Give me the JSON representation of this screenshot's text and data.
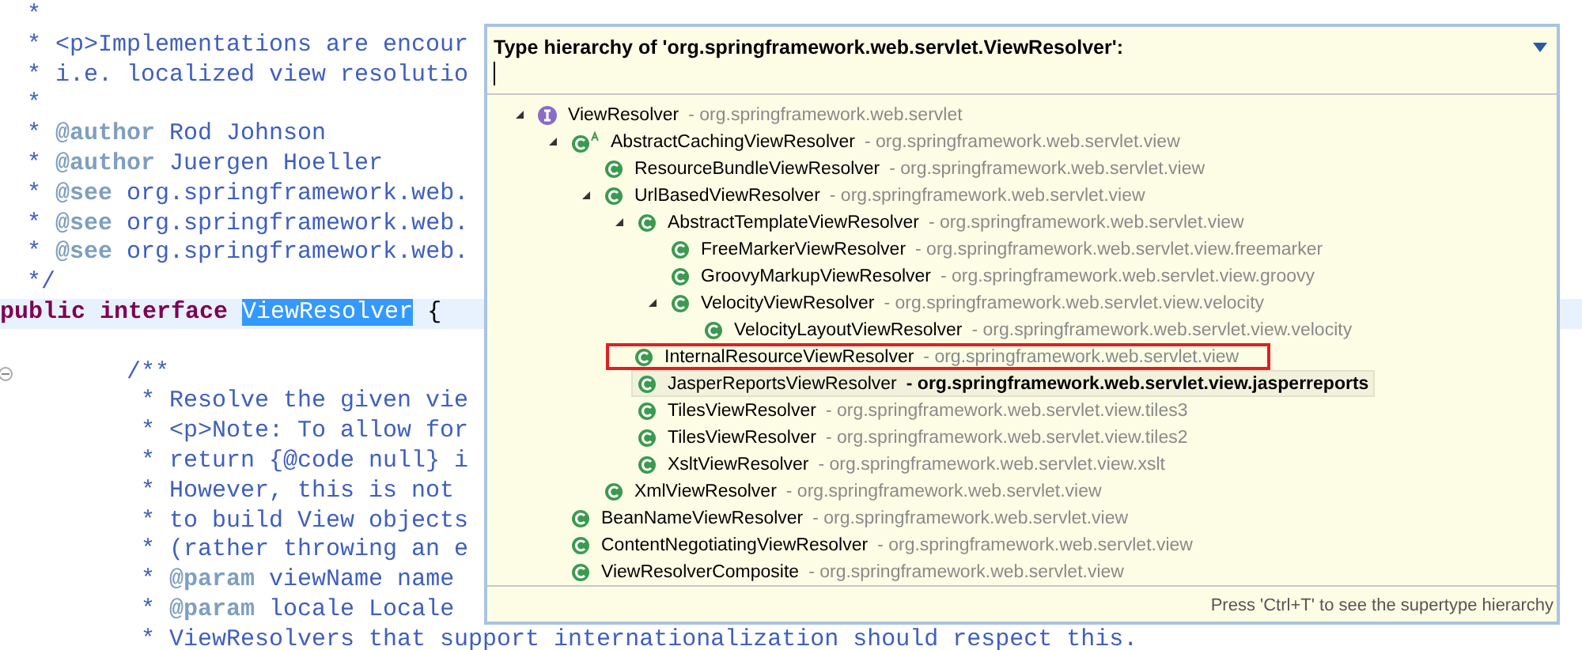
{
  "editor": {
    "lines": [
      {
        "kind": "comment",
        "text": " *"
      },
      {
        "kind": "comment",
        "text": " * <p>Implementations are encour"
      },
      {
        "kind": "comment",
        "text": " * i.e. localized view resolutio"
      },
      {
        "kind": "comment",
        "text": " *"
      },
      {
        "kind": "comment",
        "text": " * **@author** Rod Johnson"
      },
      {
        "kind": "comment",
        "text": " * **@author** Juergen Hoeller"
      },
      {
        "kind": "comment",
        "text": " * **@see** org.springframework.web."
      },
      {
        "kind": "comment",
        "text": " * **@see** org.springframework.web."
      },
      {
        "kind": "comment",
        "text": " * **@see** org.springframework.web."
      },
      {
        "kind": "comment",
        "text": " */"
      },
      {
        "kind": "declaration",
        "keywords": "public interface",
        "name": "ViewResolver",
        "name_selected": true,
        "rest": "{",
        "current": true
      },
      {
        "kind": "blank"
      },
      {
        "kind": "comment",
        "text": "        /**",
        "folded": false
      },
      {
        "kind": "comment",
        "text": "         * Resolve the given vie"
      },
      {
        "kind": "comment",
        "text": "         * <p>Note: To allow for"
      },
      {
        "kind": "comment",
        "text": "         * return {@code null} i"
      },
      {
        "kind": "comment",
        "text": "         * However, this is not"
      },
      {
        "kind": "comment",
        "text": "         * to build View objects"
      },
      {
        "kind": "comment",
        "text": "         * (rather throwing an e"
      },
      {
        "kind": "comment",
        "text": "         * **@param** viewName name"
      },
      {
        "kind": "comment",
        "text": "         * **@param** locale Locale"
      },
      {
        "kind": "comment",
        "text": "         * ViewResolvers that support internationalization should respect this."
      }
    ]
  },
  "hierarchy_popup": {
    "title": "Type hierarchy of 'org.springframework.web.servlet.ViewResolver':",
    "status": "Press 'Ctrl+T' to see the supertype hierarchy",
    "tree": [
      {
        "name": "ViewResolver",
        "package": "- org.springframework.web.servlet",
        "kind": "interface",
        "expanded": true,
        "selected": false,
        "outlined": false,
        "children": [
          {
            "name": "AbstractCachingViewResolver",
            "package": "- org.springframework.web.servlet.view",
            "kind": "abstract_class",
            "expanded": true,
            "selected": false,
            "outlined": false,
            "children": [
              {
                "name": "ResourceBundleViewResolver",
                "package": "- org.springframework.web.servlet.view",
                "kind": "class",
                "selected": false,
                "outlined": false
              },
              {
                "name": "UrlBasedViewResolver",
                "package": "- org.springframework.web.servlet.view",
                "kind": "class",
                "expanded": true,
                "selected": false,
                "outlined": false,
                "children": [
                  {
                    "name": "AbstractTemplateViewResolver",
                    "package": "- org.springframework.web.servlet.view",
                    "kind": "class",
                    "expanded": true,
                    "selected": false,
                    "outlined": false,
                    "children": [
                      {
                        "name": "FreeMarkerViewResolver",
                        "package": "- org.springframework.web.servlet.view.freemarker",
                        "kind": "class",
                        "selected": false,
                        "outlined": false
                      },
                      {
                        "name": "GroovyMarkupViewResolver",
                        "package": "- org.springframework.web.servlet.view.groovy",
                        "kind": "class",
                        "selected": false,
                        "outlined": false
                      },
                      {
                        "name": "VelocityViewResolver",
                        "package": "- org.springframework.web.servlet.view.velocity",
                        "kind": "class",
                        "expanded": true,
                        "selected": false,
                        "outlined": false,
                        "children": [
                          {
                            "name": "VelocityLayoutViewResolver",
                            "package": "- org.springframework.web.servlet.view.velocity",
                            "kind": "class",
                            "selected": false,
                            "outlined": false
                          }
                        ]
                      }
                    ]
                  },
                  {
                    "name": "InternalResourceViewResolver",
                    "package": "- org.springframework.web.servlet.view",
                    "kind": "class",
                    "selected": false,
                    "outlined": true
                  },
                  {
                    "name": "JasperReportsViewResolver",
                    "package": "- org.springframework.web.servlet.view.jasperreports",
                    "kind": "class",
                    "selected": true,
                    "outlined": false
                  },
                  {
                    "name": "TilesViewResolver",
                    "package": "- org.springframework.web.servlet.view.tiles3",
                    "kind": "class",
                    "selected": false,
                    "outlined": false
                  },
                  {
                    "name": "TilesViewResolver",
                    "package": "- org.springframework.web.servlet.view.tiles2",
                    "kind": "class",
                    "selected": false,
                    "outlined": false
                  },
                  {
                    "name": "XsltViewResolver",
                    "package": "- org.springframework.web.servlet.view.xslt",
                    "kind": "class",
                    "selected": false,
                    "outlined": false
                  }
                ]
              },
              {
                "name": "XmlViewResolver",
                "package": "- org.springframework.web.servlet.view",
                "kind": "class",
                "selected": false,
                "outlined": false
              }
            ]
          },
          {
            "name": "BeanNameViewResolver",
            "package": "- org.springframework.web.servlet.view",
            "kind": "class",
            "selected": false,
            "outlined": false
          },
          {
            "name": "ContentNegotiatingViewResolver",
            "package": "- org.springframework.web.servlet.view",
            "kind": "class",
            "selected": false,
            "outlined": false
          },
          {
            "name": "ViewResolverComposite",
            "package": "- org.springframework.web.servlet.view",
            "kind": "class",
            "selected": false,
            "outlined": false
          }
        ]
      }
    ]
  }
}
